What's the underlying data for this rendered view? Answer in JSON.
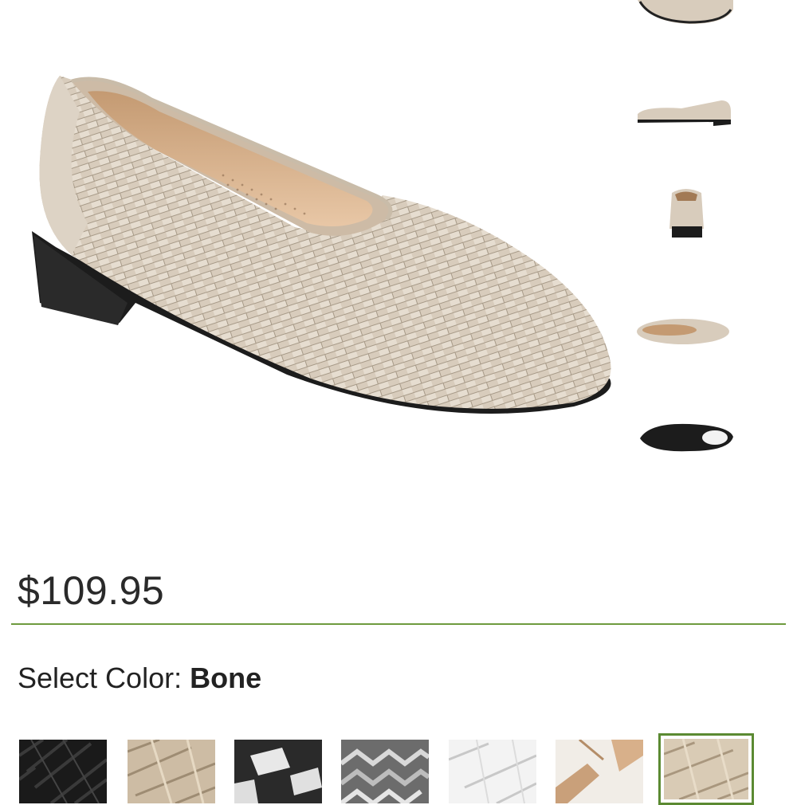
{
  "product": {
    "price": "$109.95",
    "select_color_label": "Select Color: ",
    "selected_color": "Bone"
  },
  "thumbnails": [
    {
      "name": "top-view"
    },
    {
      "name": "side-view"
    },
    {
      "name": "back-view"
    },
    {
      "name": "inner-side-view"
    },
    {
      "name": "sole-view"
    }
  ],
  "swatches": [
    {
      "name": "black-weave"
    },
    {
      "name": "gold-weave"
    },
    {
      "name": "black-white-weave"
    },
    {
      "name": "grey-herringbone"
    },
    {
      "name": "white-weave"
    },
    {
      "name": "white-tan-weave"
    },
    {
      "name": "bone-weave",
      "selected": true
    }
  ],
  "colors": {
    "accent": "#5b8a32",
    "divider": "#6e9a3e",
    "bone": "#d9cfc0",
    "sole": "#1c1c1c"
  }
}
